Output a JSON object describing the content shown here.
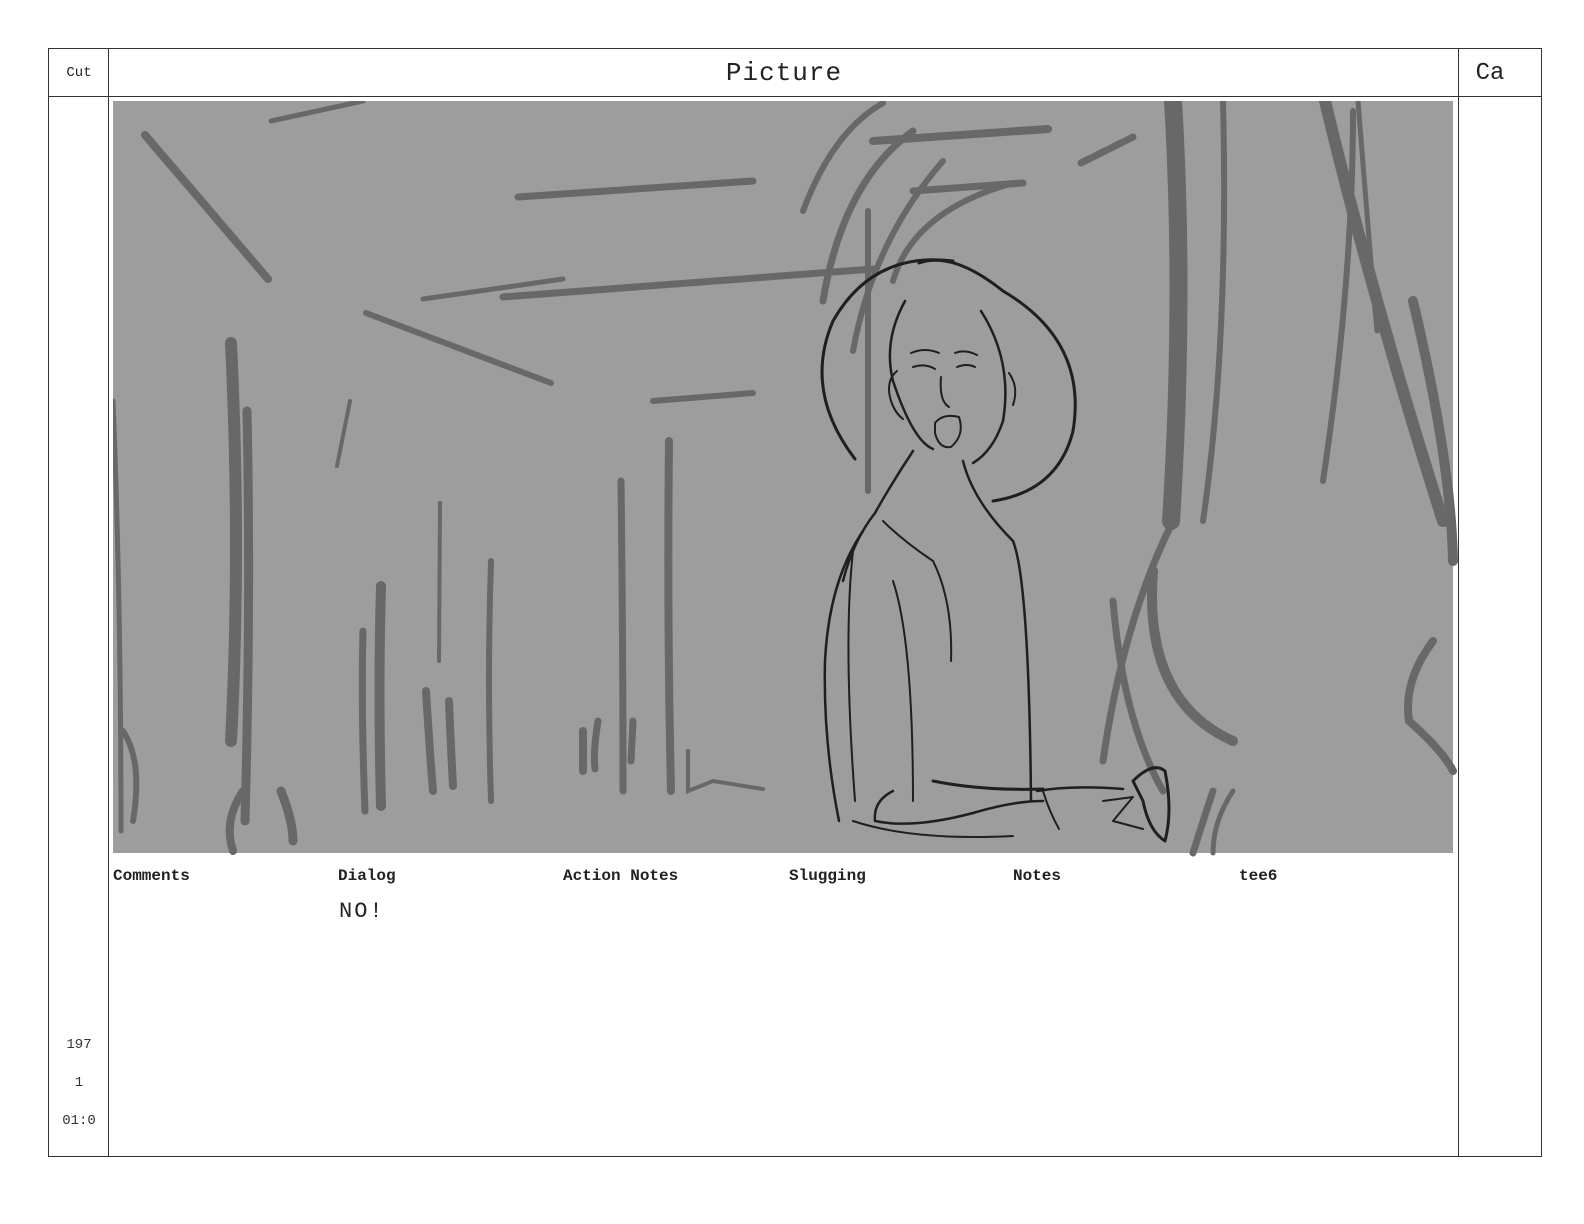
{
  "header": {
    "cut_label": "Cut",
    "picture_label": "Picture",
    "camera_label": "Ca"
  },
  "panel": {
    "sketch_icon": "storyboard-sketch-man-in-forest"
  },
  "fields": {
    "comments_label": "Comments",
    "dialog_label": "Dialog",
    "action_notes_label": "Action Notes",
    "slugging_label": "Slugging",
    "notes_label": "Notes",
    "tee6_label": "tee6"
  },
  "dialog": {
    "text": "NO!"
  },
  "side": {
    "scene": "197",
    "panel_number": "1",
    "timecode": "01:0"
  },
  "colors": {
    "panel_bg": "#9d9d9d",
    "sketch_mid": "#686868",
    "sketch_dark": "#1f1f1f",
    "border": "#333333"
  }
}
